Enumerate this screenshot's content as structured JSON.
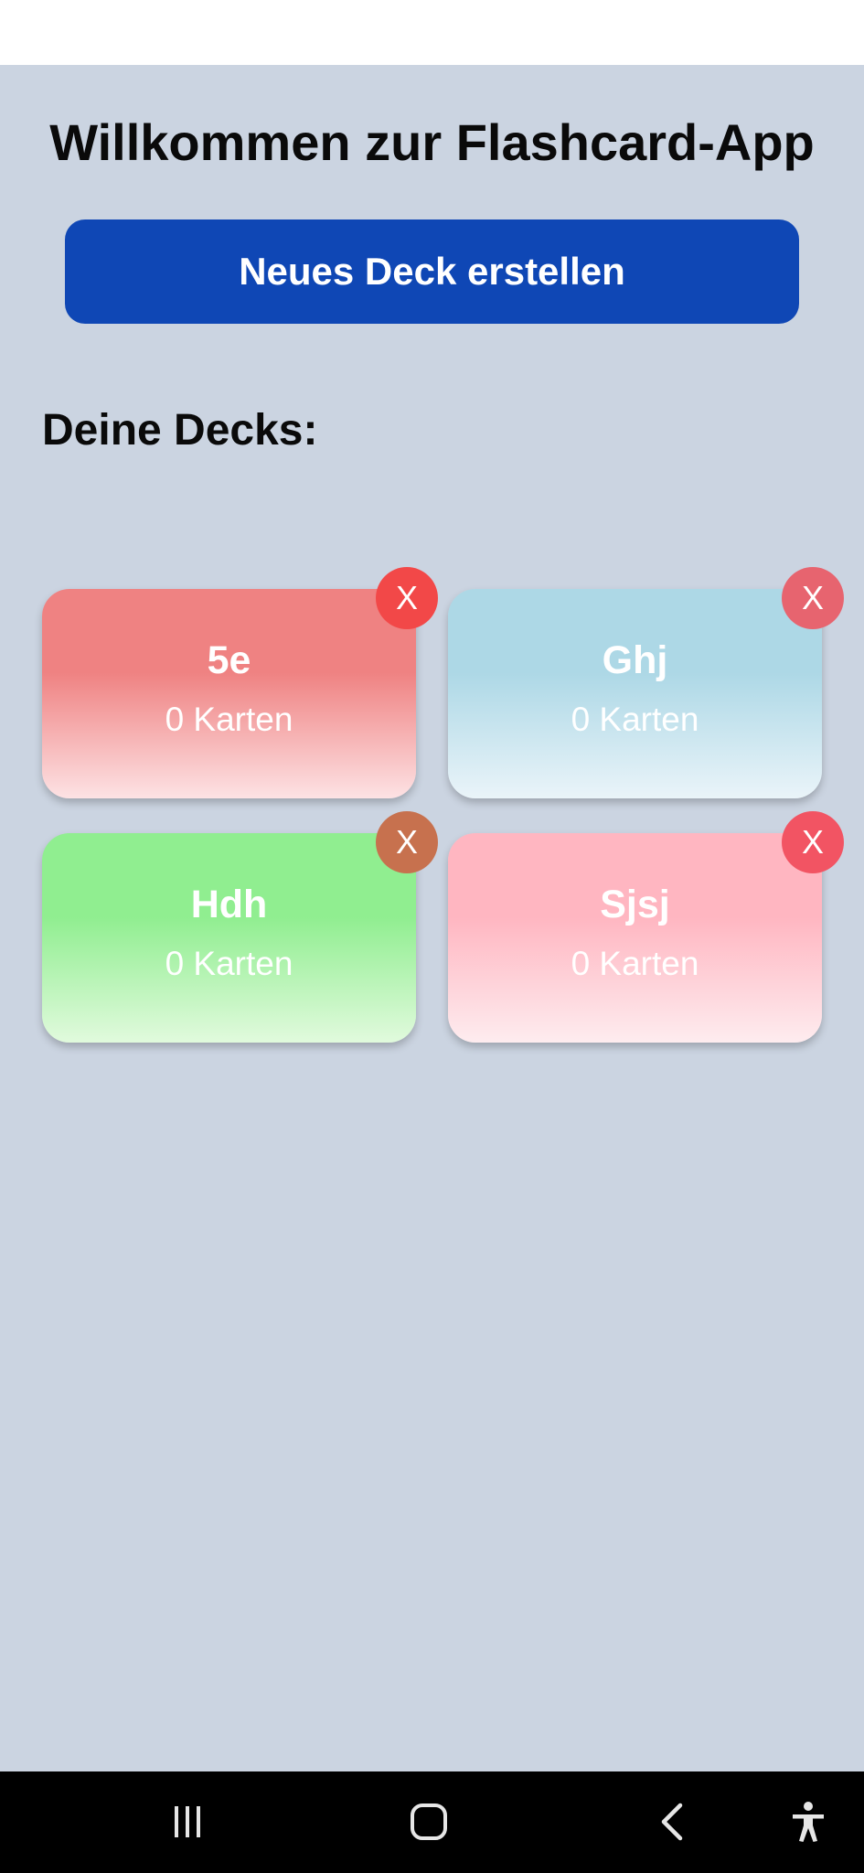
{
  "app": {
    "title": "Willkommen zur Flashcard-App",
    "new_deck_label": "Neues Deck erstellen",
    "decks_heading": "Deine Decks:"
  },
  "decks": [
    {
      "name": "5e",
      "count": "0 Karten",
      "delete_label": "X",
      "gradient_top": "#ef8282",
      "gradient_bottom": "#fde2e4",
      "delete_color": "#f24848"
    },
    {
      "name": "Ghj",
      "count": "0 Karten",
      "delete_label": "X",
      "gradient_top": "#add8e6",
      "gradient_bottom": "#eaf4f9",
      "delete_color": "#e7646f"
    },
    {
      "name": "Hdh",
      "count": "0 Karten",
      "delete_label": "X",
      "gradient_top": "#90ee90",
      "gradient_bottom": "#e1fadd",
      "delete_color": "#c7714e"
    },
    {
      "name": "Sjsj",
      "count": "0 Karten",
      "delete_label": "X",
      "gradient_top": "#ffb6c1",
      "gradient_bottom": "#feecef",
      "delete_color": "#f25463"
    }
  ],
  "nav": {
    "icons": [
      "recent-apps-icon",
      "home-icon",
      "back-icon",
      "accessibility-icon"
    ]
  },
  "colors": {
    "background": "#cbd4e1",
    "primary_button": "#0f47b5"
  }
}
